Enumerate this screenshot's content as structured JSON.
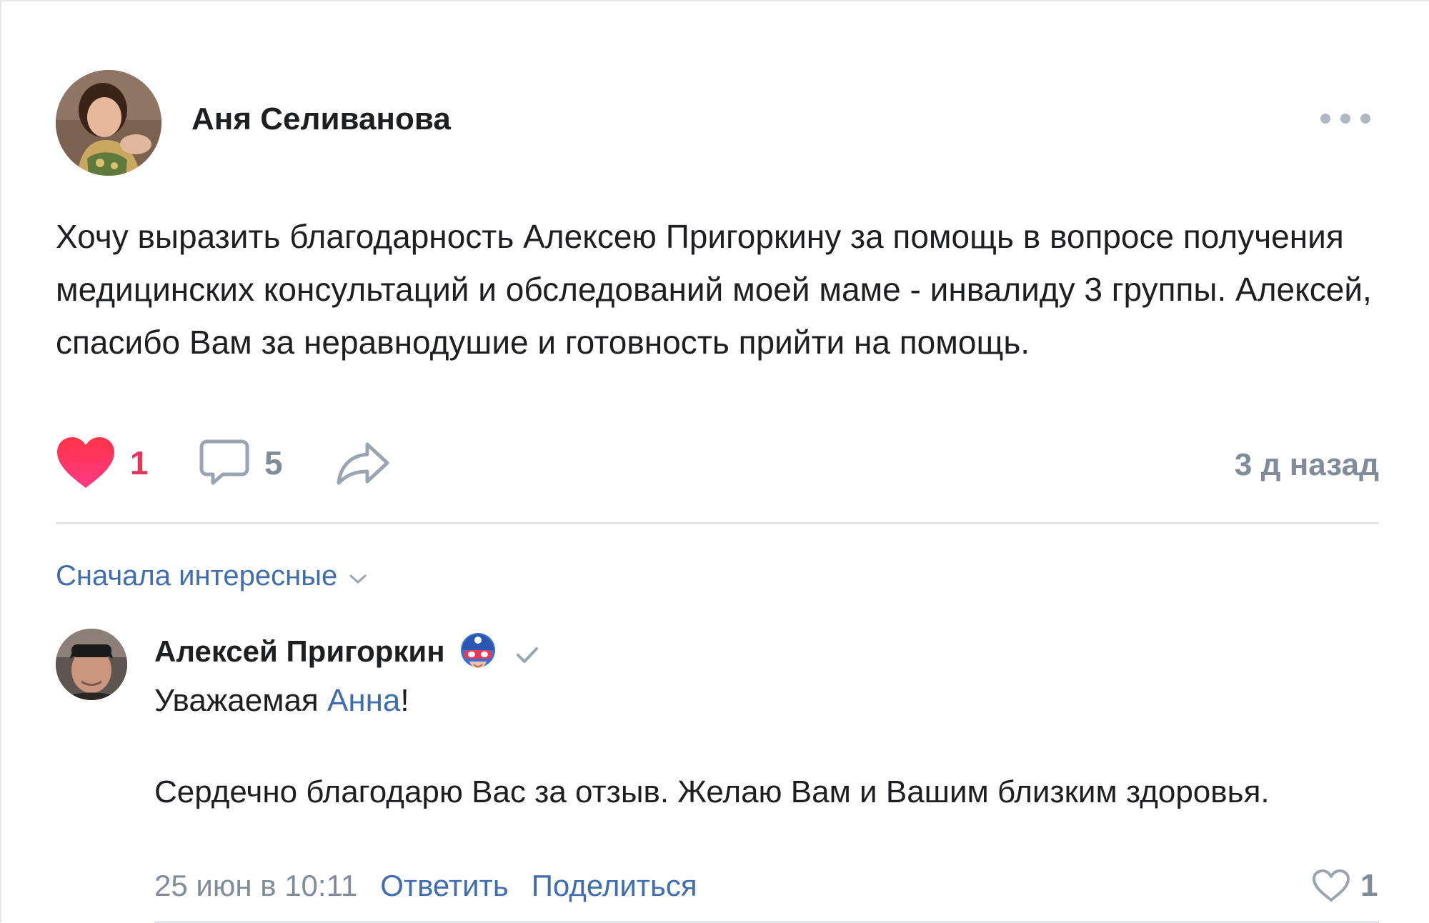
{
  "post": {
    "author": "Аня Селиванова",
    "avatar_icon": "user-avatar-photo",
    "more_icon": "more-horizontal-icon",
    "text": "Хочу выразить благодарность Алексею Пригоркину за помощь в вопросе получения медицинских консультаций и обследований моей маме - инвалиду 3 группы. Алексей, спасибо Вам за неравнодушие и готовность прийти на помощь.",
    "likes": "1",
    "comments": "5",
    "time": "3 д назад",
    "like_icon": "heart-filled-icon",
    "comment_icon": "comment-bubble-icon",
    "share_icon": "share-arrow-icon"
  },
  "sort": {
    "label": "Сначала интересные",
    "icon": "chevron-down-icon"
  },
  "comment": {
    "author": "Алексей Пригоркин",
    "badge_icon": "hero-mask-badge-icon",
    "verified_icon": "checkmark-icon",
    "greeting_prefix": "Уважаемая ",
    "mention": "Анна",
    "greeting_suffix": "!",
    "body": "Сердечно благодарю Вас за отзыв. Желаю Вам и Вашим близким здоровья.",
    "date": "25 июн в 10:11",
    "reply_label": "Ответить",
    "share_label": "Поделиться",
    "likes": "1",
    "like_icon": "heart-outline-icon"
  },
  "colors": {
    "accent": "#3f6db0",
    "like_red": "#e6375a",
    "secondary_text": "#818c99",
    "divider": "#e4e6ea"
  }
}
